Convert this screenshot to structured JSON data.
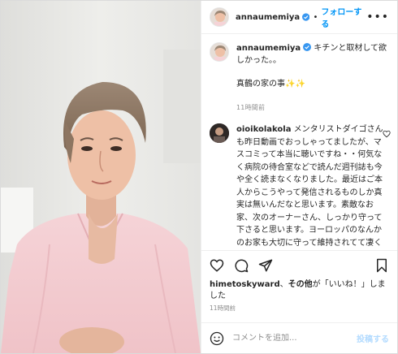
{
  "header": {
    "username": "annaumemiya",
    "separator": "•",
    "follow_label": "フォローする",
    "more_label": "•••"
  },
  "caption": {
    "username": "annaumemiya",
    "text": " キチンと取材して欲",
    "text_line2": "しかった。。",
    "extra": "真鶴の家の事",
    "emoji": "✨✨",
    "time": "11時間前"
  },
  "comment": {
    "username": "oioikolakola",
    "text": " メンタリストダイゴさんも昨日動画でおっしゃってましたが、マスコミって本当に聴いですね・・何気なく病院の待合室などで読んだ週刊誌も今や全く読まなくなりました。最近はご本人からこうやって発信されるものしか真実は無いんだなと思います。素敵なお家、次のオーナーさん、しっかり守って下さると思います。ヨーロッパのなんかのお家も大切に守って維持されてて凄く素敵な事ですよね〜",
    "emoji": "🙂"
  },
  "likes": {
    "user": "himetoskyward",
    "middle": "、",
    "others": "その他",
    "suffix": "が「いいね！」しました",
    "time": "11時間前"
  },
  "add_comment": {
    "placeholder": "コメントを追加...",
    "post_label": "投稿する"
  },
  "icons": {
    "verified": "verified-badge-icon",
    "like": "heart-icon",
    "comment": "comment-icon",
    "share": "share-icon",
    "save": "bookmark-icon",
    "emoji": "smiley-icon"
  },
  "colors": {
    "link_blue": "#0095f6",
    "post_disabled": "#b3dbff",
    "muted": "#8e8e8e",
    "text": "#262626"
  }
}
